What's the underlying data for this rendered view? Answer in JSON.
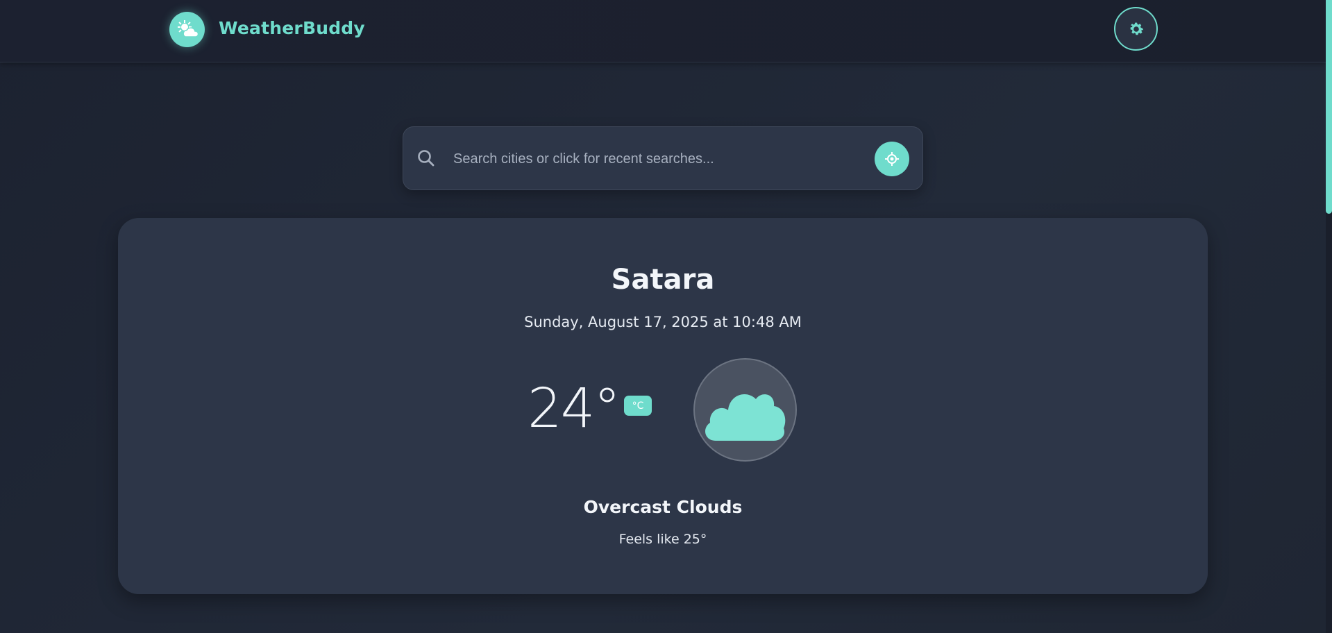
{
  "app": {
    "name": "WeatherBuddy",
    "logo_icon": "weather-partly-cloudy-icon",
    "settings_icon": "gear-icon"
  },
  "search": {
    "placeholder": "Search cities or click for recent searches...",
    "value": "",
    "search_icon": "search-icon",
    "locate_icon": "crosshair-location-icon"
  },
  "weather": {
    "city": "Satara",
    "datetime": "Sunday, August 17, 2025 at 10:48 AM",
    "temperature": "24°",
    "unit": "°C",
    "condition_icon": "cloud-icon",
    "condition": "Overcast Clouds",
    "feels_like": "Feels like 25°"
  },
  "colors": {
    "accent": "#6fdccc",
    "background": "#1f2533",
    "card": "#2d3648"
  }
}
